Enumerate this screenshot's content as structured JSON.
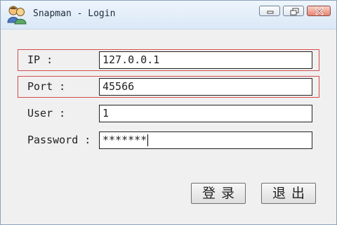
{
  "window": {
    "title": "Snapman - Login",
    "controls": {
      "minimize": "minimize-icon",
      "maximize": "maximize-icon",
      "close": "close-icon"
    }
  },
  "form": {
    "ip": {
      "label": "IP :",
      "value": "127.0.0.1"
    },
    "port": {
      "label": "Port :",
      "value": "45566"
    },
    "user": {
      "label": "User :",
      "value": "1"
    },
    "password": {
      "label": "Password :",
      "value": "*******"
    }
  },
  "buttons": {
    "login": "登录",
    "exit": "退出"
  },
  "colors": {
    "highlight": "#d64c4c",
    "title_bar": "#dbe8f6"
  }
}
